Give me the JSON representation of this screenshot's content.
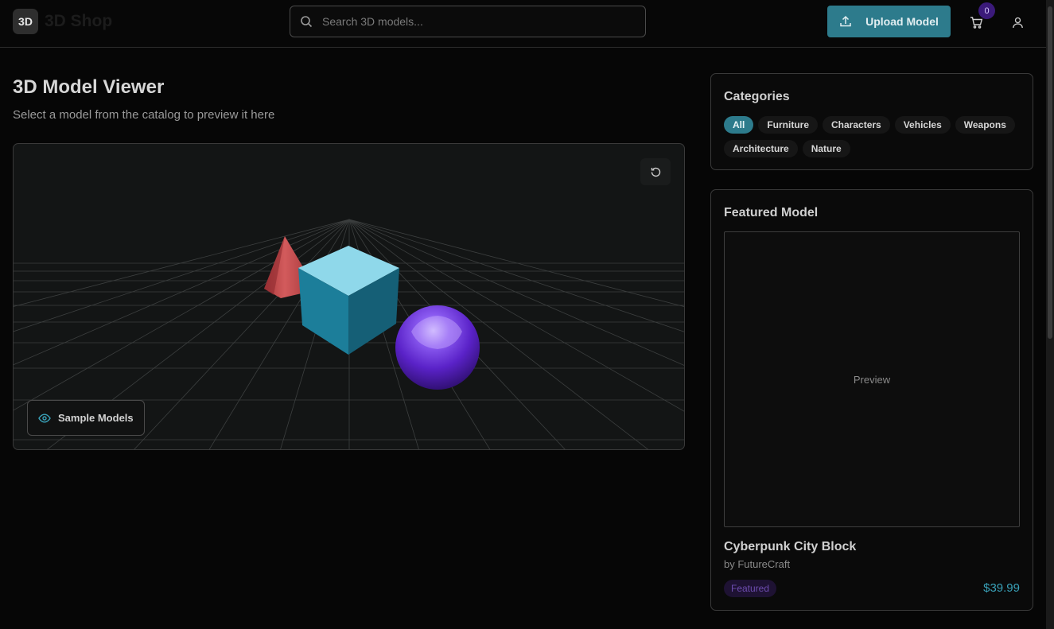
{
  "header": {
    "logo_mark": "3D",
    "logo_text": "3D Shop",
    "search_placeholder": "Search 3D models...",
    "upload_label": "Upload Model",
    "cart_count": "0"
  },
  "main": {
    "title": "3D Model Viewer",
    "subtitle": "Select a model from the catalog to preview it here",
    "sample_models_label": "Sample Models"
  },
  "categories": {
    "title": "Categories",
    "items": [
      "All",
      "Furniture",
      "Characters",
      "Vehicles",
      "Weapons",
      "Architecture",
      "Nature"
    ],
    "active": "All"
  },
  "featured": {
    "title": "Featured Model",
    "preview_label": "Preview",
    "name": "Cyberpunk City Block",
    "author": "by FutureCraft",
    "badge": "Featured",
    "price": "$39.99"
  },
  "colors": {
    "accent": "#2d7b8c",
    "badge_purple": "#3b1a7a",
    "price": "#39a1b8"
  }
}
